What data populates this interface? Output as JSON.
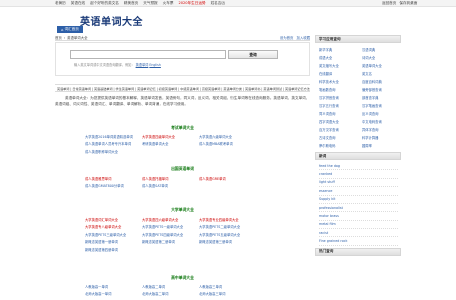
{
  "topbar": {
    "links": [
      "老黄历",
      "英语在线",
      "起个好听的英文名",
      "精美首页",
      "天气预报",
      "火车票",
      "2020年生日运势",
      "姓名吉凶"
    ],
    "right": [
      "返回首页",
      "保存到桌面"
    ]
  },
  "site_title": "英语单词大全",
  "home_tab": {
    "icon": "home-icon",
    "label": "词汇首页"
  },
  "breadcrumb": {
    "items": [
      "首页",
      "英语单词大全"
    ],
    "right": [
      "设为首页",
      "加入收藏"
    ]
  },
  "search": {
    "placeholder": "",
    "button": "查询",
    "hint_prefix": "输入英文单词或中文词语查询翻译，例如：",
    "hint_links": [
      "英语单词",
      "English"
    ]
  },
  "categories": "英语单词 | 日常英语单词 | 英语基础单词 | 学生英语单词 | 英语单词记忆 | 初级英语单词 | 中级英语单词 | 高级英语单词 | 英语单词分类 | 英语单词书 | 英语单词测试 | 英语单词记忆方法 | 英语单词2021",
  "intro": "英语单词大全：为您提供英语单词的基本解释，英语单词发音，英语例句，同义词，反义词，相关词组，衍生单词等在线查询服务。英语单词、英文单词、英语词组、词义词性、英语词汇、单词翻译、单词解析、单词背诵，在线学习使用。",
  "sections": [
    {
      "title": "考试单词大全",
      "items": [
        {
          "text": "大学英语2016单词英语精选单词",
          "red": false
        },
        {
          "text": "大学英语四级单词大全",
          "red": true
        },
        {
          "text": "大学英语六级单词大全",
          "red": false
        },
        {
          "text": "成人英语单词人员考专升本单词",
          "red": false
        },
        {
          "text": "考研英语单词大全",
          "red": false
        },
        {
          "text": "成人英语MBA联考单词",
          "red": false
        },
        {
          "text": "成人英语职称单词大全",
          "red": false
        },
        {
          "text": "",
          "red": false
        },
        {
          "text": "",
          "red": false
        }
      ]
    },
    {
      "title": "出国英语单词",
      "items": [
        {
          "text": "成人英语雅思单词",
          "red": true
        },
        {
          "text": "成人英语托福单词",
          "red": true
        },
        {
          "text": "成人英语GRE单词",
          "red": true
        },
        {
          "text": "成人英语GMAT800分单词",
          "red": false
        },
        {
          "text": "成人英语SAT单词",
          "red": false
        },
        {
          "text": "",
          "red": false
        }
      ]
    },
    {
      "title": "大学单词大全",
      "items": [
        {
          "text": "大学英语词汇单词大全",
          "red": true
        },
        {
          "text": "大学英语四六级单词大全",
          "red": true
        },
        {
          "text": "大学英语专业四级单词大全",
          "red": true
        },
        {
          "text": "大学英语专八级单词大全",
          "red": true
        },
        {
          "text": "大学英语PETS一级单词大全",
          "red": false
        },
        {
          "text": "大学英语PETS二级单词大全",
          "red": false
        },
        {
          "text": "大学英语PETS三级单词大全",
          "red": false
        },
        {
          "text": "大学英语PETS四级单词大全",
          "red": false
        },
        {
          "text": "大学英语PETS五级单词大全",
          "red": false
        },
        {
          "text": "新概念英语第一册单词",
          "red": false
        },
        {
          "text": "新概念英语第二册单词",
          "red": false
        },
        {
          "text": "新概念英语第三册单词",
          "red": false
        },
        {
          "text": "新概念英语第四册单词",
          "red": false
        },
        {
          "text": "",
          "red": false
        },
        {
          "text": "",
          "red": false
        }
      ]
    },
    {
      "title": "高中单词大全",
      "items": [
        {
          "text": "人教版高一单词",
          "red": false
        },
        {
          "text": "人教版高二单词",
          "red": false
        },
        {
          "text": "人教版高三单词",
          "red": false
        },
        {
          "text": "北师大版高一单词",
          "red": false
        },
        {
          "text": "北师大版高二单词",
          "red": false
        },
        {
          "text": "北师大版高三单词",
          "red": false
        }
      ]
    }
  ],
  "sidebar": {
    "tools_title": "学习应用查询",
    "tools": [
      "新华字典",
      "汉语词典",
      "成语大全",
      "诗词大全",
      "英文缩写大全",
      "英语单词大全",
      "在线翻译",
      "英文名",
      "科学技术大全",
      "百度百科词典",
      "笔画数查询",
      "偏旁部首查询",
      "汉字拼音查询",
      "部首查字典",
      "汉字五行查询",
      "汉字笔画查询",
      "同义词查询",
      "反义词查询",
      "四字词语大全",
      "中文电码查询",
      "百万汉字查询",
      "异体字查询",
      "古诗文查询",
      "科学计算器",
      "摩尔斯电码",
      "圆周率"
    ],
    "new_title": "新词",
    "new_items": [
      "feed the dog",
      "cranked",
      "light stuff",
      "essence",
      "Supply kit",
      "professionalist",
      "motor brass",
      "metal film",
      "racist",
      "Fine grained rock"
    ],
    "hot_title": "热门查询"
  }
}
